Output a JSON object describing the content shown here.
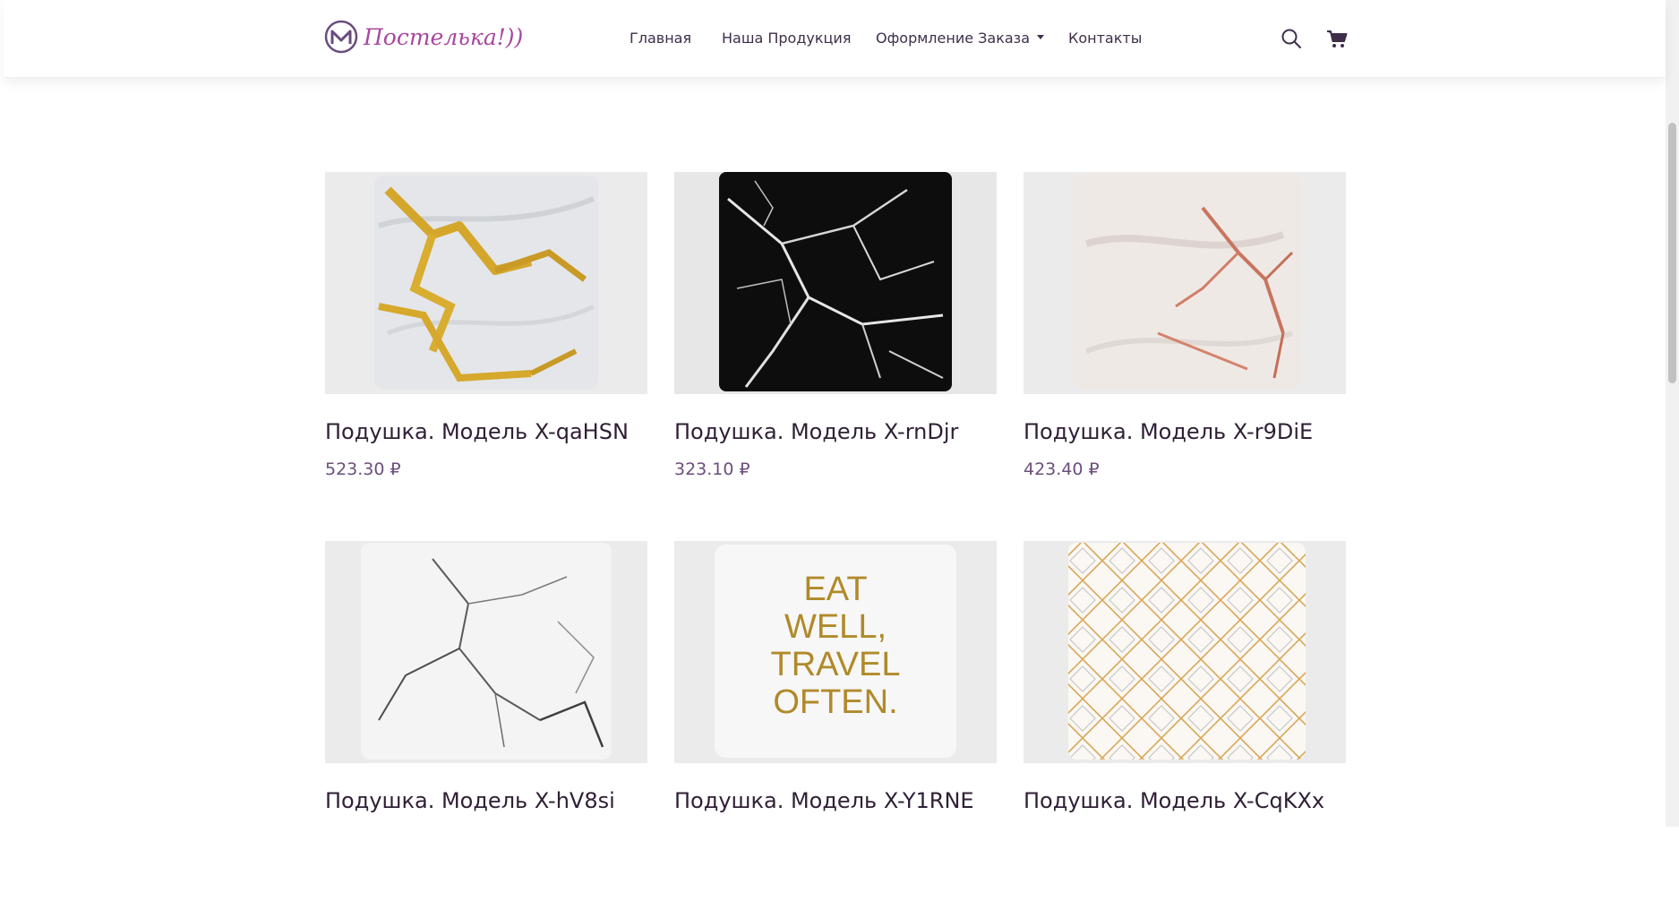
{
  "brand": {
    "name": "Постелька!))",
    "icon": "m-circle-logo-icon",
    "color": "#a8479f"
  },
  "nav": {
    "items": [
      {
        "label": "Главная"
      },
      {
        "label": "Наша Продукция"
      },
      {
        "label": "Оформление Заказа",
        "dropdown": true
      },
      {
        "label": "Контакты"
      }
    ]
  },
  "header_icons": {
    "search": "search-icon",
    "cart": "cart-icon"
  },
  "products": [
    {
      "title": "Подушка. Модель X-qaHSN",
      "price": "523.30 ₽",
      "pattern": "gold-marble"
    },
    {
      "title": "Подушка. Модель X-rnDjr",
      "price": "323.10 ₽",
      "pattern": "black-marble"
    },
    {
      "title": "Подушка. Модель X-r9DiE",
      "price": "423.40 ₽",
      "pattern": "rose-marble"
    },
    {
      "title": "Подушка. Модель X-hV8si",
      "price": "",
      "pattern": "white-marble"
    },
    {
      "title": "Подушка. Модель X-Y1RNE",
      "price": "",
      "pattern": "text-pillow",
      "pillow_text": [
        "EAT",
        "WELL,",
        "TRAVEL",
        "OFTEN."
      ]
    },
    {
      "title": "Подушка. Модель X-CqKXx",
      "price": "",
      "pattern": "geometric"
    }
  ],
  "colors": {
    "text": "#3f2e4a",
    "price": "#6b4e7d",
    "accent": "#a8479f"
  }
}
